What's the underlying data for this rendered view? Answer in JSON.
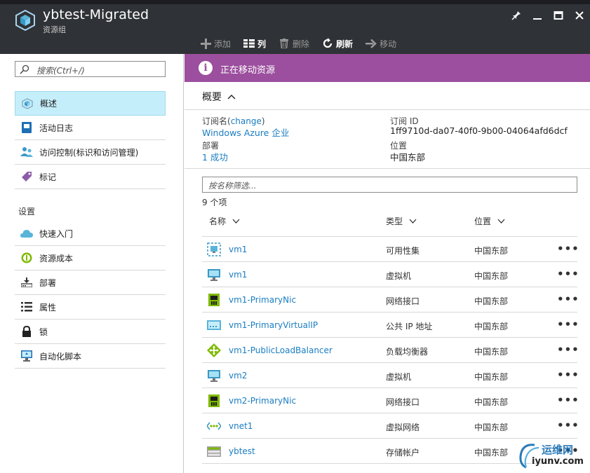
{
  "header": {
    "title": "ybtest-Migrated",
    "subtitle": "资源组",
    "icon": "resource-group-cube-icon",
    "window_controls": [
      "pin-icon",
      "minimize-icon",
      "maximize-icon",
      "close-icon"
    ]
  },
  "toolbar": {
    "add_label": "添加",
    "columns_label": "列",
    "delete_label": "删除",
    "refresh_label": "刷新",
    "move_label": "移动"
  },
  "left_menu": {
    "search_placeholder": "搜索(Ctrl+/)",
    "items": [
      {
        "label": "概述",
        "icon": "overview-cube-icon",
        "active": true
      },
      {
        "label": "活动日志",
        "icon": "activity-log-icon"
      },
      {
        "label": "访问控制(标识和访问管理)",
        "icon": "access-control-icon"
      },
      {
        "label": "标记",
        "icon": "tag-icon"
      }
    ],
    "settings_label": "设置",
    "settings_items": [
      {
        "label": "快速入门",
        "icon": "quickstart-cloud-icon"
      },
      {
        "label": "资源成本",
        "icon": "resource-cost-icon"
      },
      {
        "label": "部署",
        "icon": "deployment-icon"
      },
      {
        "label": "属性",
        "icon": "properties-icon"
      },
      {
        "label": "锁",
        "icon": "lock-icon"
      },
      {
        "label": "自动化脚本",
        "icon": "automation-script-icon"
      }
    ]
  },
  "notice": {
    "text": "正在移动资源",
    "icon": "info-icon",
    "color": "#9c4f9e"
  },
  "essentials": {
    "header": "概要",
    "subscription_label": "订阅名",
    "subscription_change": "change",
    "subscription_value": "Windows Azure 企业",
    "subscription_id_label": "订阅 ID",
    "subscription_id_value": "1ff9710d-da07-40f0-9b00-04064afd6dcf",
    "deployment_label": "部署",
    "deployment_value": "1 成功",
    "location_label": "位置",
    "location_value": "中国东部"
  },
  "resources": {
    "filter_placeholder": "按名称筛选...",
    "count_text": "9 个项",
    "columns": {
      "name": "名称",
      "type": "类型",
      "location": "位置"
    },
    "rows": [
      {
        "name": "vm1",
        "type": "可用性集",
        "location": "中国东部",
        "icon": "availability-set-icon"
      },
      {
        "name": "vm1",
        "type": "虚拟机",
        "location": "中国东部",
        "icon": "virtual-machine-icon"
      },
      {
        "name": "vm1-PrimaryNic",
        "type": "网络接口",
        "location": "中国东部",
        "icon": "network-interface-icon"
      },
      {
        "name": "vm1-PrimaryVirtualIP",
        "type": "公共 IP 地址",
        "location": "中国东部",
        "icon": "public-ip-icon"
      },
      {
        "name": "vm1-PublicLoadBalancer",
        "type": "负载均衡器",
        "location": "中国东部",
        "icon": "load-balancer-icon"
      },
      {
        "name": "vm2",
        "type": "虚拟机",
        "location": "中国东部",
        "icon": "virtual-machine-icon"
      },
      {
        "name": "vm2-PrimaryNic",
        "type": "网络接口",
        "location": "中国东部",
        "icon": "network-interface-icon"
      },
      {
        "name": "vnet1",
        "type": "虚拟网络",
        "location": "中国东部",
        "icon": "virtual-network-icon"
      },
      {
        "name": "ybtest",
        "type": "存储帐户",
        "location": "中国东部",
        "icon": "storage-account-icon"
      }
    ],
    "more_label": "•••"
  },
  "watermark": {
    "cn": "运维网",
    "en": "iyunv.com"
  },
  "colors": {
    "header_bg": "#2f3236",
    "link": "#1a7dc2",
    "active_menu_bg": "#c5eefb",
    "notice_bg": "#9c4f9e"
  }
}
